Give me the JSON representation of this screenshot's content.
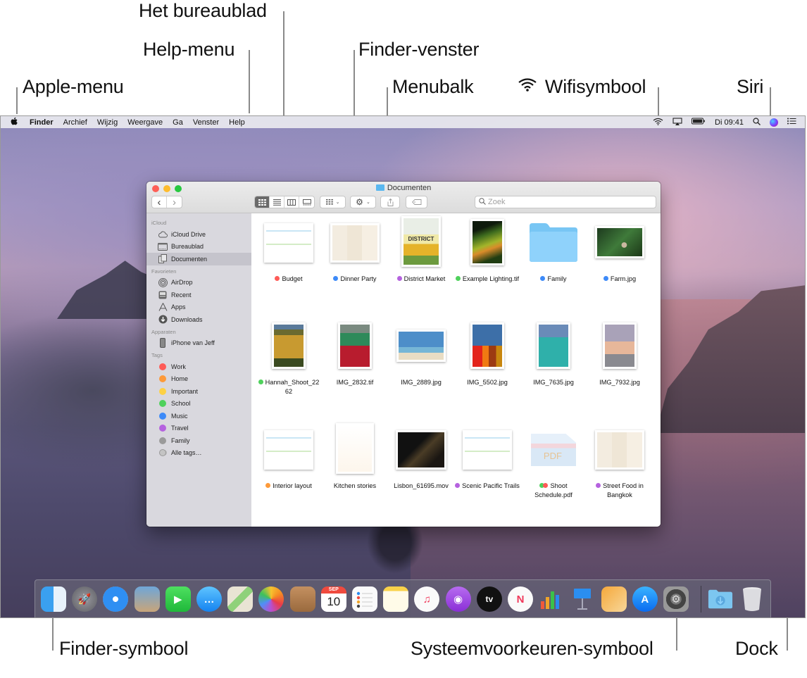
{
  "callouts": {
    "het_bureaublad": "Het bureaublad",
    "help_menu": "Help-menu",
    "finder_venster": "Finder-venster",
    "apple_menu": "Apple-menu",
    "menubalk": "Menubalk",
    "wifisymbool": "Wifisymbool",
    "siri": "Siri",
    "finder_symbool": "Finder-symbool",
    "systeemvoorkeuren_symbool": "Systeemvoorkeuren-symbool",
    "dock": "Dock"
  },
  "menubar": {
    "apple_icon": "apple-logo",
    "items": [
      "Finder",
      "Archief",
      "Wijzig",
      "Weergave",
      "Ga",
      "Venster",
      "Help"
    ],
    "status": {
      "wifi_icon": "wifi",
      "airplay_icon": "airplay",
      "battery_icon": "battery",
      "clock": "Di 09:41",
      "spotlight_icon": "search",
      "siri_icon": "siri",
      "notification_icon": "list"
    }
  },
  "finder": {
    "title": "Documenten",
    "toolbar": {
      "back": "‹",
      "forward": "›",
      "view_modes": [
        "icon",
        "list",
        "columns",
        "gallery"
      ],
      "active_view": "icon",
      "group_label": "group",
      "action_label": "action",
      "share_label": "share",
      "tags_label": "tags"
    },
    "search": {
      "placeholder": "Zoek"
    },
    "sidebar": {
      "sections": [
        {
          "title": "iCloud",
          "items": [
            {
              "label": "iCloud Drive",
              "icon": "cloud"
            },
            {
              "label": "Bureaublad",
              "icon": "desktop"
            },
            {
              "label": "Documenten",
              "icon": "document",
              "selected": true
            }
          ]
        },
        {
          "title": "Favorieten",
          "items": [
            {
              "label": "AirDrop",
              "icon": "airdrop"
            },
            {
              "label": "Recent",
              "icon": "recent"
            },
            {
              "label": "Apps",
              "icon": "apps"
            },
            {
              "label": "Downloads",
              "icon": "download"
            }
          ]
        },
        {
          "title": "Apparaten",
          "items": [
            {
              "label": "iPhone van Jeff",
              "icon": "iphone"
            }
          ]
        }
      ],
      "tags_title": "Tags",
      "tags": [
        {
          "label": "Work",
          "color": "#fe5b57"
        },
        {
          "label": "Home",
          "color": "#fd9a3a"
        },
        {
          "label": "Important",
          "color": "#fdd145"
        },
        {
          "label": "School",
          "color": "#4fd15c"
        },
        {
          "label": "Music",
          "color": "#3d8af8"
        },
        {
          "label": "Travel",
          "color": "#b562df"
        },
        {
          "label": "Family",
          "color": "#9a9a9a"
        },
        {
          "label": "Alle tags…",
          "color": "#c4c4c4"
        }
      ]
    },
    "files": [
      {
        "name": "Budget",
        "tags": [
          "#fe5b57"
        ],
        "kind": "spreadsheet"
      },
      {
        "name": "Dinner Party",
        "tags": [
          "#3d8af8"
        ],
        "kind": "document-landscape"
      },
      {
        "name": "District Market",
        "tags": [
          "#b562df"
        ],
        "kind": "poster"
      },
      {
        "name": "Example Lighting.tif",
        "tags": [
          "#4fd15c"
        ],
        "kind": "photo-portrait"
      },
      {
        "name": "Family",
        "tags": [
          "#3d8af8"
        ],
        "kind": "folder"
      },
      {
        "name": "Farm.jpg",
        "tags": [
          "#3d8af8"
        ],
        "kind": "photo-landscape"
      },
      {
        "name": "Hannah_Shoot_2262",
        "tags": [
          "#4fd15c"
        ],
        "kind": "photo-portrait"
      },
      {
        "name": "IMG_2832.tif",
        "tags": [],
        "kind": "photo-portrait"
      },
      {
        "name": "IMG_2889.jpg",
        "tags": [],
        "kind": "photo-landscape"
      },
      {
        "name": "IMG_5502.jpg",
        "tags": [],
        "kind": "photo-portrait"
      },
      {
        "name": "IMG_7635.jpg",
        "tags": [],
        "kind": "photo-portrait"
      },
      {
        "name": "IMG_7932.jpg",
        "tags": [],
        "kind": "photo-portrait"
      },
      {
        "name": "Interior layout",
        "tags": [
          "#fd9a3a"
        ],
        "kind": "spreadsheet"
      },
      {
        "name": "Kitchen stories",
        "tags": [],
        "kind": "document-portrait"
      },
      {
        "name": "Lisbon_61695.mov",
        "tags": [],
        "kind": "video"
      },
      {
        "name": "Scenic Pacific Trails",
        "tags": [
          "#b562df"
        ],
        "kind": "spreadsheet"
      },
      {
        "name": "Shoot Schedule.pdf",
        "tags": [
          "#4fd15c",
          "#fe5b57"
        ],
        "kind": "pdf"
      },
      {
        "name": "Street Food in Bangkok",
        "tags": [
          "#b562df"
        ],
        "kind": "document-landscape"
      }
    ]
  },
  "dock": {
    "apps": [
      {
        "name": "Finder",
        "icon": "finder"
      },
      {
        "name": "Launchpad",
        "icon": "launchpad"
      },
      {
        "name": "Safari",
        "icon": "safari"
      },
      {
        "name": "Mail",
        "icon": "mail"
      },
      {
        "name": "FaceTime",
        "icon": "facetime"
      },
      {
        "name": "Berichten",
        "icon": "messages"
      },
      {
        "name": "Kaarten",
        "icon": "maps"
      },
      {
        "name": "Foto's",
        "icon": "photos"
      },
      {
        "name": "Contacten",
        "icon": "contacts"
      },
      {
        "name": "Agenda",
        "icon": "calendar",
        "month": "SEP",
        "day": "10"
      },
      {
        "name": "Herinneringen",
        "icon": "reminders"
      },
      {
        "name": "Notities",
        "icon": "notes"
      },
      {
        "name": "Muziek",
        "icon": "music"
      },
      {
        "name": "Podcasts",
        "icon": "podcasts"
      },
      {
        "name": "TV",
        "icon": "tv",
        "label": "tv"
      },
      {
        "name": "News",
        "icon": "news"
      },
      {
        "name": "Numbers",
        "icon": "numbers"
      },
      {
        "name": "Keynote",
        "icon": "keynote"
      },
      {
        "name": "Pages",
        "icon": "pages"
      },
      {
        "name": "App Store",
        "icon": "appstore"
      },
      {
        "name": "Systeemvoorkeuren",
        "icon": "system-preferences"
      }
    ],
    "stacks": [
      {
        "name": "Downloads",
        "icon": "downloads-folder"
      },
      {
        "name": "Prullenmand",
        "icon": "trash"
      }
    ]
  }
}
